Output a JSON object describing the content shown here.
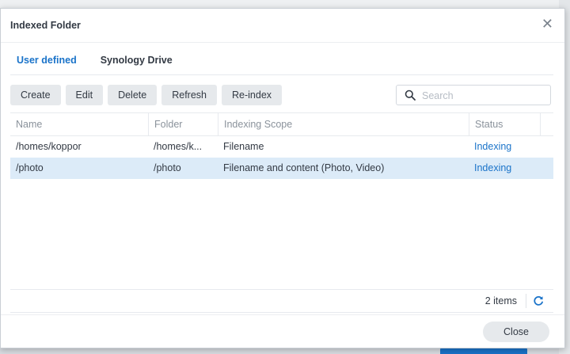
{
  "dialog": {
    "title": "Indexed Folder"
  },
  "tabs": [
    {
      "label": "User defined",
      "active": true
    },
    {
      "label": "Synology Drive",
      "active": false
    }
  ],
  "toolbar": {
    "create_label": "Create",
    "edit_label": "Edit",
    "delete_label": "Delete",
    "refresh_label": "Refresh",
    "reindex_label": "Re-index"
  },
  "search": {
    "placeholder": "Search",
    "value": ""
  },
  "table": {
    "columns": [
      "Name",
      "Folder",
      "Indexing Scope",
      "Status"
    ],
    "rows": [
      {
        "name": "/homes/koppor",
        "folder": "/homes/k...",
        "scope": "Filename",
        "status": "Indexing",
        "selected": false
      },
      {
        "name": "/photo",
        "folder": "/photo",
        "scope": "Filename and content (Photo, Video)",
        "status": "Indexing",
        "selected": true
      }
    ]
  },
  "footer": {
    "items_count": "2 items",
    "close_label": "Close"
  },
  "colors": {
    "accent": "#1a73c9",
    "selected_row": "#dcebf8",
    "button_bg": "#e6e9ec"
  },
  "icons": {
    "close": "close-icon",
    "search": "search-icon",
    "refresh": "refresh-icon"
  }
}
